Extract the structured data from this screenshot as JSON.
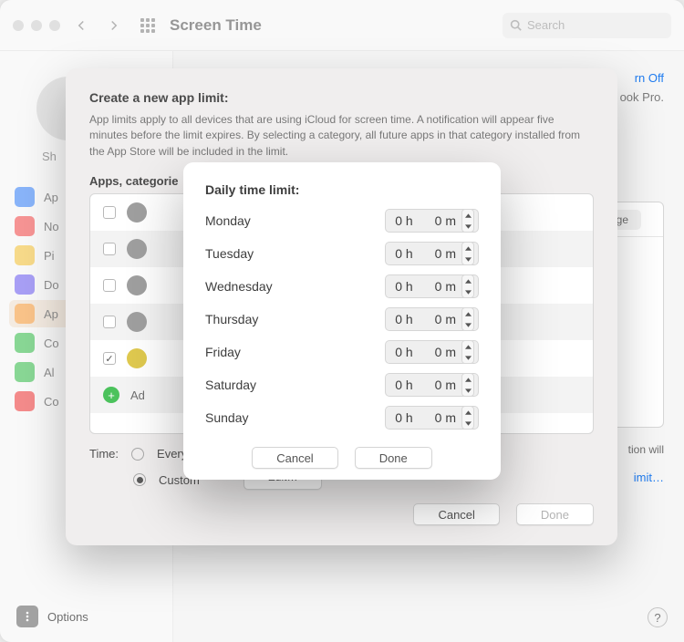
{
  "window": {
    "title": "Screen Time",
    "search_placeholder": "Search"
  },
  "sidebar": {
    "user_short": "Sh",
    "items": [
      {
        "label": "Ap",
        "color": "#4a8cf6"
      },
      {
        "label": "No",
        "color": "#f15b5b"
      },
      {
        "label": "Pi",
        "color": "#f3c64c"
      },
      {
        "label": "Do",
        "color": "#7a6cf0"
      },
      {
        "label": "Ap",
        "color": "#f6a34b"
      },
      {
        "label": "Co",
        "color": "#4bc25c"
      },
      {
        "label": "Al",
        "color": "#4bc25c"
      },
      {
        "label": "Co",
        "color": "#ef4e4e"
      }
    ]
  },
  "content": {
    "turn_off": "rn Off",
    "device_tail": "ook Pro.",
    "seg": "Average",
    "note_tail": "tion will",
    "link_tail": "imit…"
  },
  "sheet1": {
    "title": "Create a new app limit:",
    "desc": "App limits apply to all devices that are using iCloud for screen time. A notification will appear five minutes before the limit expires. By selecting a category, all future apps in that category installed from the App Store will be included in the limit.",
    "list_label": "Apps, categorie",
    "add_label": "Ad",
    "time_label": "Time:",
    "radio_every": "Every",
    "radio_custom": "Custom",
    "edit": "Edit…",
    "cancel": "Cancel",
    "done": "Done"
  },
  "sheet2": {
    "title": "Daily time limit:",
    "days": [
      {
        "name": "Monday",
        "h": "0",
        "m": "0"
      },
      {
        "name": "Tuesday",
        "h": "0",
        "m": "0"
      },
      {
        "name": "Wednesday",
        "h": "0",
        "m": "0"
      },
      {
        "name": "Thursday",
        "h": "0",
        "m": "0"
      },
      {
        "name": "Friday",
        "h": "0",
        "m": "0"
      },
      {
        "name": "Saturday",
        "h": "0",
        "m": "0"
      },
      {
        "name": "Sunday",
        "h": "0",
        "m": "0"
      }
    ],
    "h_unit": "h",
    "m_unit": "m",
    "cancel": "Cancel",
    "done": "Done"
  },
  "footer": {
    "options": "Options"
  }
}
